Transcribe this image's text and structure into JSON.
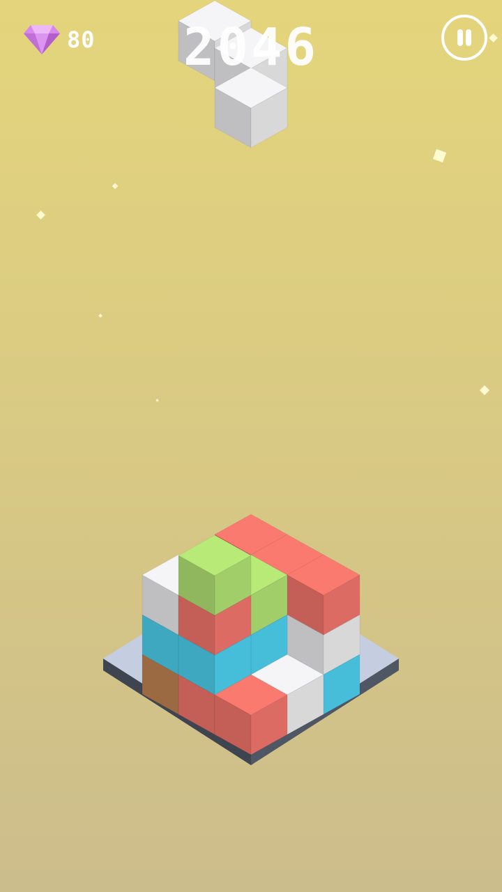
{
  "hud": {
    "gems": "80",
    "score": "2046",
    "gem_icon": "diamond-icon",
    "pause_icon": "pause-icon"
  },
  "colors": {
    "background_top": "#e4d57c",
    "background_bottom": "#ccbd8c",
    "cube_white": "#f5f5f7",
    "cube_lime": "#b8ea78",
    "cube_coral": "#fa7a70",
    "cube_cyan": "#4fd8f7",
    "cube_orange": "#c88854",
    "platform": "#c4cee0",
    "platform_edge": "#3f4550",
    "gem": "#d788ea"
  }
}
